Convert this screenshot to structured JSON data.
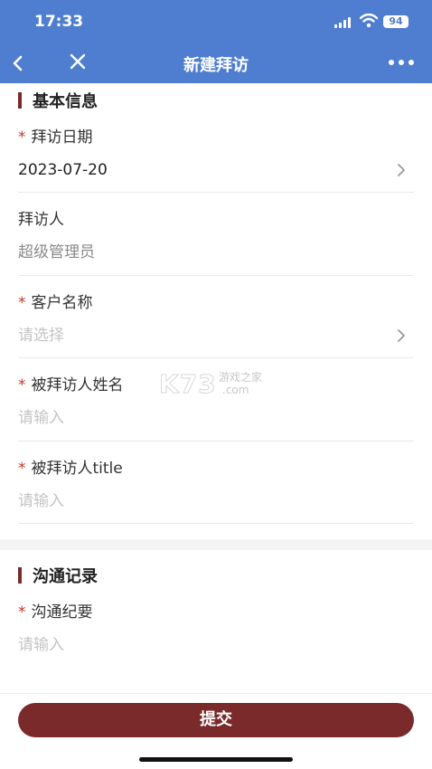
{
  "status_bar": {
    "time": "17:33",
    "battery": "94"
  },
  "nav": {
    "title": "新建拜访"
  },
  "section_basic": {
    "title": "基本信息"
  },
  "fields": {
    "visit_date": {
      "required": "*",
      "label": "拜访日期",
      "value": "2023-07-20"
    },
    "visitor": {
      "label": "拜访人",
      "value": "超级管理员"
    },
    "customer": {
      "required": "*",
      "label": "客户名称",
      "placeholder": "请选择"
    },
    "visitee_name": {
      "required": "*",
      "label": "被拜访人姓名",
      "placeholder": "请输入"
    },
    "visitee_title": {
      "required": "*",
      "label": "被拜访人title",
      "placeholder": "请输入"
    },
    "summary": {
      "required": "*",
      "label": "沟通纪要",
      "placeholder": "请输入"
    }
  },
  "section_comm": {
    "title": "沟通记录"
  },
  "submit": {
    "label": "提交"
  },
  "watermark": {
    "big": "K73",
    "small1": "游戏之家",
    "small2": ".com"
  },
  "colors": {
    "brand_blue": "#4f7ed0",
    "accent": "#7a2a2a",
    "required": "#c0392b"
  }
}
